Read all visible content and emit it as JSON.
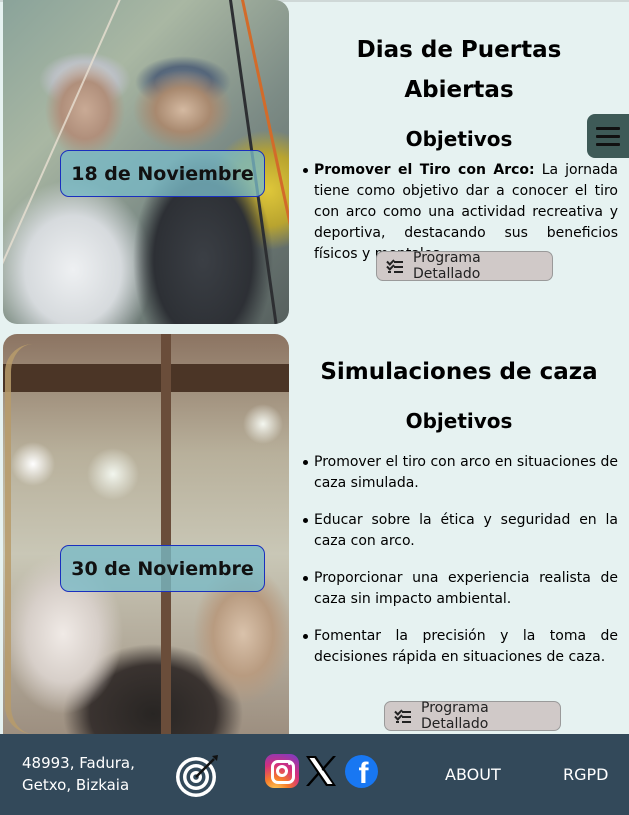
{
  "events": [
    {
      "date": "18 de Noviembre",
      "title": "Dias de Puertas Abiertas",
      "subtitle": "Objetivos",
      "items": [
        {
          "bold": "Promover el Tiro con Arco:",
          "text": " La jornada tiene como objetivo dar a conocer el tiro con arco como una actividad recreativa y deportiva, destacando sus beneficios físicos y mentales."
        }
      ],
      "button_label": "Programa Detallado"
    },
    {
      "date": "30 de Noviembre",
      "title": "Simulaciones de caza",
      "subtitle": "Objetivos",
      "items": [
        {
          "bold": "",
          "text": "Promover el tiro con arco en situaciones de caza simulada."
        },
        {
          "bold": "",
          "text": "Educar sobre la ética y seguridad en la caza con arco."
        },
        {
          "bold": "",
          "text": "Proporcionar una experiencia realista de caza sin impacto ambiental."
        },
        {
          "bold": "",
          "text": "Fomentar la precisión y la toma de decisiones rápida en situaciones de caza."
        }
      ],
      "button_label": "Programa Detallado"
    }
  ],
  "menu": {
    "icon": "hamburger-menu-icon"
  },
  "footer": {
    "address_line1": "48993, Fadura,",
    "address_line2": "Getxo, Bizkaia",
    "logo_icon": "archery-target-icon",
    "social": [
      "instagram-icon",
      "x-icon",
      "facebook-icon"
    ],
    "links": {
      "about": "ABOUT",
      "rgpd": "RGPD"
    }
  },
  "colors": {
    "page_bg": "#e6f2f1",
    "footer_bg": "#33495a",
    "badge_border": "#1a2fbf",
    "button_bg": "#d0c9c8",
    "menu_bg": "#3e5a57"
  }
}
